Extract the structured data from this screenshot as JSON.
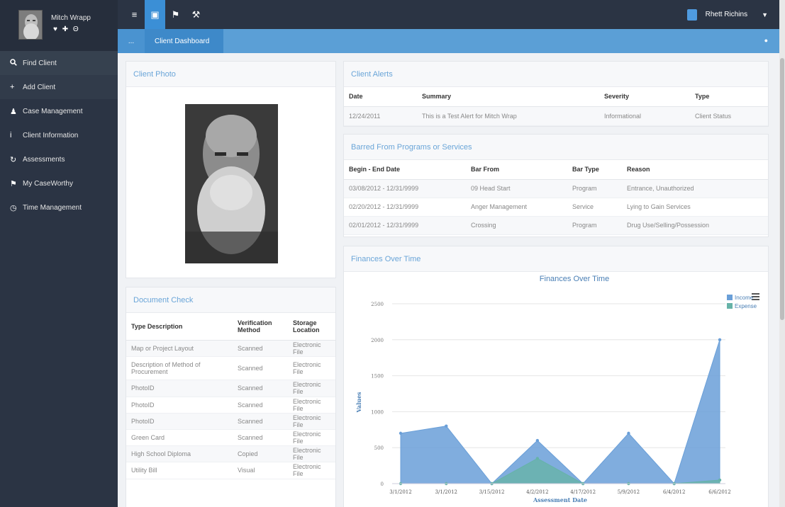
{
  "profile": {
    "name": "Mitch Wrapp",
    "icons": "♥ ✚ Θ"
  },
  "nav": [
    {
      "label": "Find Client",
      "icon": "🔍"
    },
    {
      "label": "Add Client",
      "icon": "+"
    },
    {
      "label": "Case Management",
      "icon": "♟"
    },
    {
      "label": "Client Information",
      "icon": "i"
    },
    {
      "label": "Assessments",
      "icon": "↻"
    },
    {
      "label": "My CaseWorthy",
      "icon": "⚑"
    },
    {
      "label": "Time Management",
      "icon": "◷"
    }
  ],
  "topbar": {
    "buttons": [
      "≡",
      "▣",
      "⚑",
      "⚒"
    ],
    "user_name": "Rhett Richins"
  },
  "breadcrumb": {
    "home": "...",
    "current": "Client Dashboard",
    "right_icon": "●"
  },
  "client_photo": {
    "title": "Client Photo"
  },
  "document_check": {
    "title": "Document Check",
    "headers": [
      "Type Description",
      "Verification Method",
      "Storage Location"
    ],
    "rows": [
      [
        "Map or Project Layout",
        "Scanned",
        "Electronic File"
      ],
      [
        "Description of Method of Procurement",
        "Scanned",
        "Electronic File"
      ],
      [
        "PhotoID",
        "Scanned",
        "Electronic File"
      ],
      [
        "PhotoID",
        "Scanned",
        "Electronic File"
      ],
      [
        "PhotoID",
        "Scanned",
        "Electronic File"
      ],
      [
        "Green Card",
        "Scanned",
        "Electronic File"
      ],
      [
        "High School Diploma",
        "Copied",
        "Electronic File"
      ],
      [
        "Utility Bill",
        "Visual",
        "Electronic File"
      ]
    ]
  },
  "client_alerts": {
    "title": "Client Alerts",
    "headers": [
      "Date",
      "Summary",
      "Severity",
      "Type"
    ],
    "rows": [
      [
        "12/24/2011",
        "This is a Test Alert for Mitch Wrap",
        "Informational",
        "Client Status"
      ]
    ]
  },
  "barred": {
    "title": "Barred From Programs or Services",
    "headers": [
      "Begin - End Date",
      "Bar From",
      "Bar Type",
      "Reason"
    ],
    "rows": [
      [
        "03/08/2012 - 12/31/9999",
        "09 Head Start",
        "Program",
        "Entrance, Unauthorized"
      ],
      [
        "02/20/2012 - 12/31/9999",
        "Anger Management",
        "Service",
        "Lying to Gain Services"
      ],
      [
        "02/01/2012 - 12/31/9999",
        "Crossing",
        "Program",
        "Drug Use/Selling/Possession"
      ]
    ]
  },
  "finances": {
    "panel_title": "Finances Over Time"
  },
  "chart_data": {
    "type": "area",
    "title": "Finances Over Time",
    "xlabel": "Assessment Date",
    "ylabel": "Values",
    "ylim": [
      0,
      2500
    ],
    "yticks": [
      0,
      500,
      1000,
      1500,
      2000,
      2500
    ],
    "categories": [
      "3/1/2012",
      "3/1/2012",
      "3/15/2012",
      "4/2/2012",
      "4/17/2012",
      "5/9/2012",
      "6/4/2012",
      "6/6/2012"
    ],
    "series": [
      {
        "name": "Income",
        "color": "#6a9fd8",
        "values": [
          700,
          800,
          0,
          600,
          0,
          700,
          0,
          2000
        ]
      },
      {
        "name": "Expense",
        "color": "#66b3a8",
        "values": [
          0,
          0,
          0,
          350,
          0,
          0,
          0,
          50
        ]
      }
    ],
    "legend": "top-right",
    "grid": true
  }
}
